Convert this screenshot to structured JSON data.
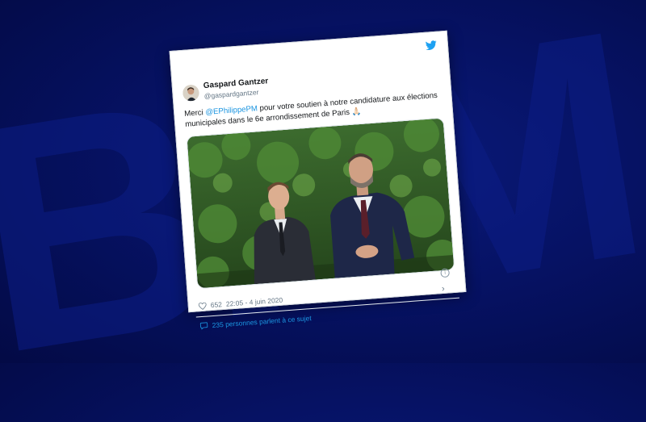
{
  "background": {
    "brand_mark": "BFM",
    "color": "#061264"
  },
  "tweet": {
    "author_name": "Gaspard Gantzer",
    "author_handle": "@gaspardgantzer",
    "text_before": "Merci ",
    "mention": "@EPhilippePM",
    "text_after": " pour votre soutien à notre candidature aux élections municipales dans le 6e arrondissement de Paris 🙏🏻",
    "likes": "652",
    "timestamp": "22:05 - 4 juin 2020",
    "replies_text": "235 personnes parlent à ce sujet",
    "accent_color": "#1da1f2"
  },
  "icons": [
    "twitter-bird-icon",
    "info-icon",
    "heart-icon",
    "chevron-right-icon",
    "speech-bubble-icon"
  ]
}
